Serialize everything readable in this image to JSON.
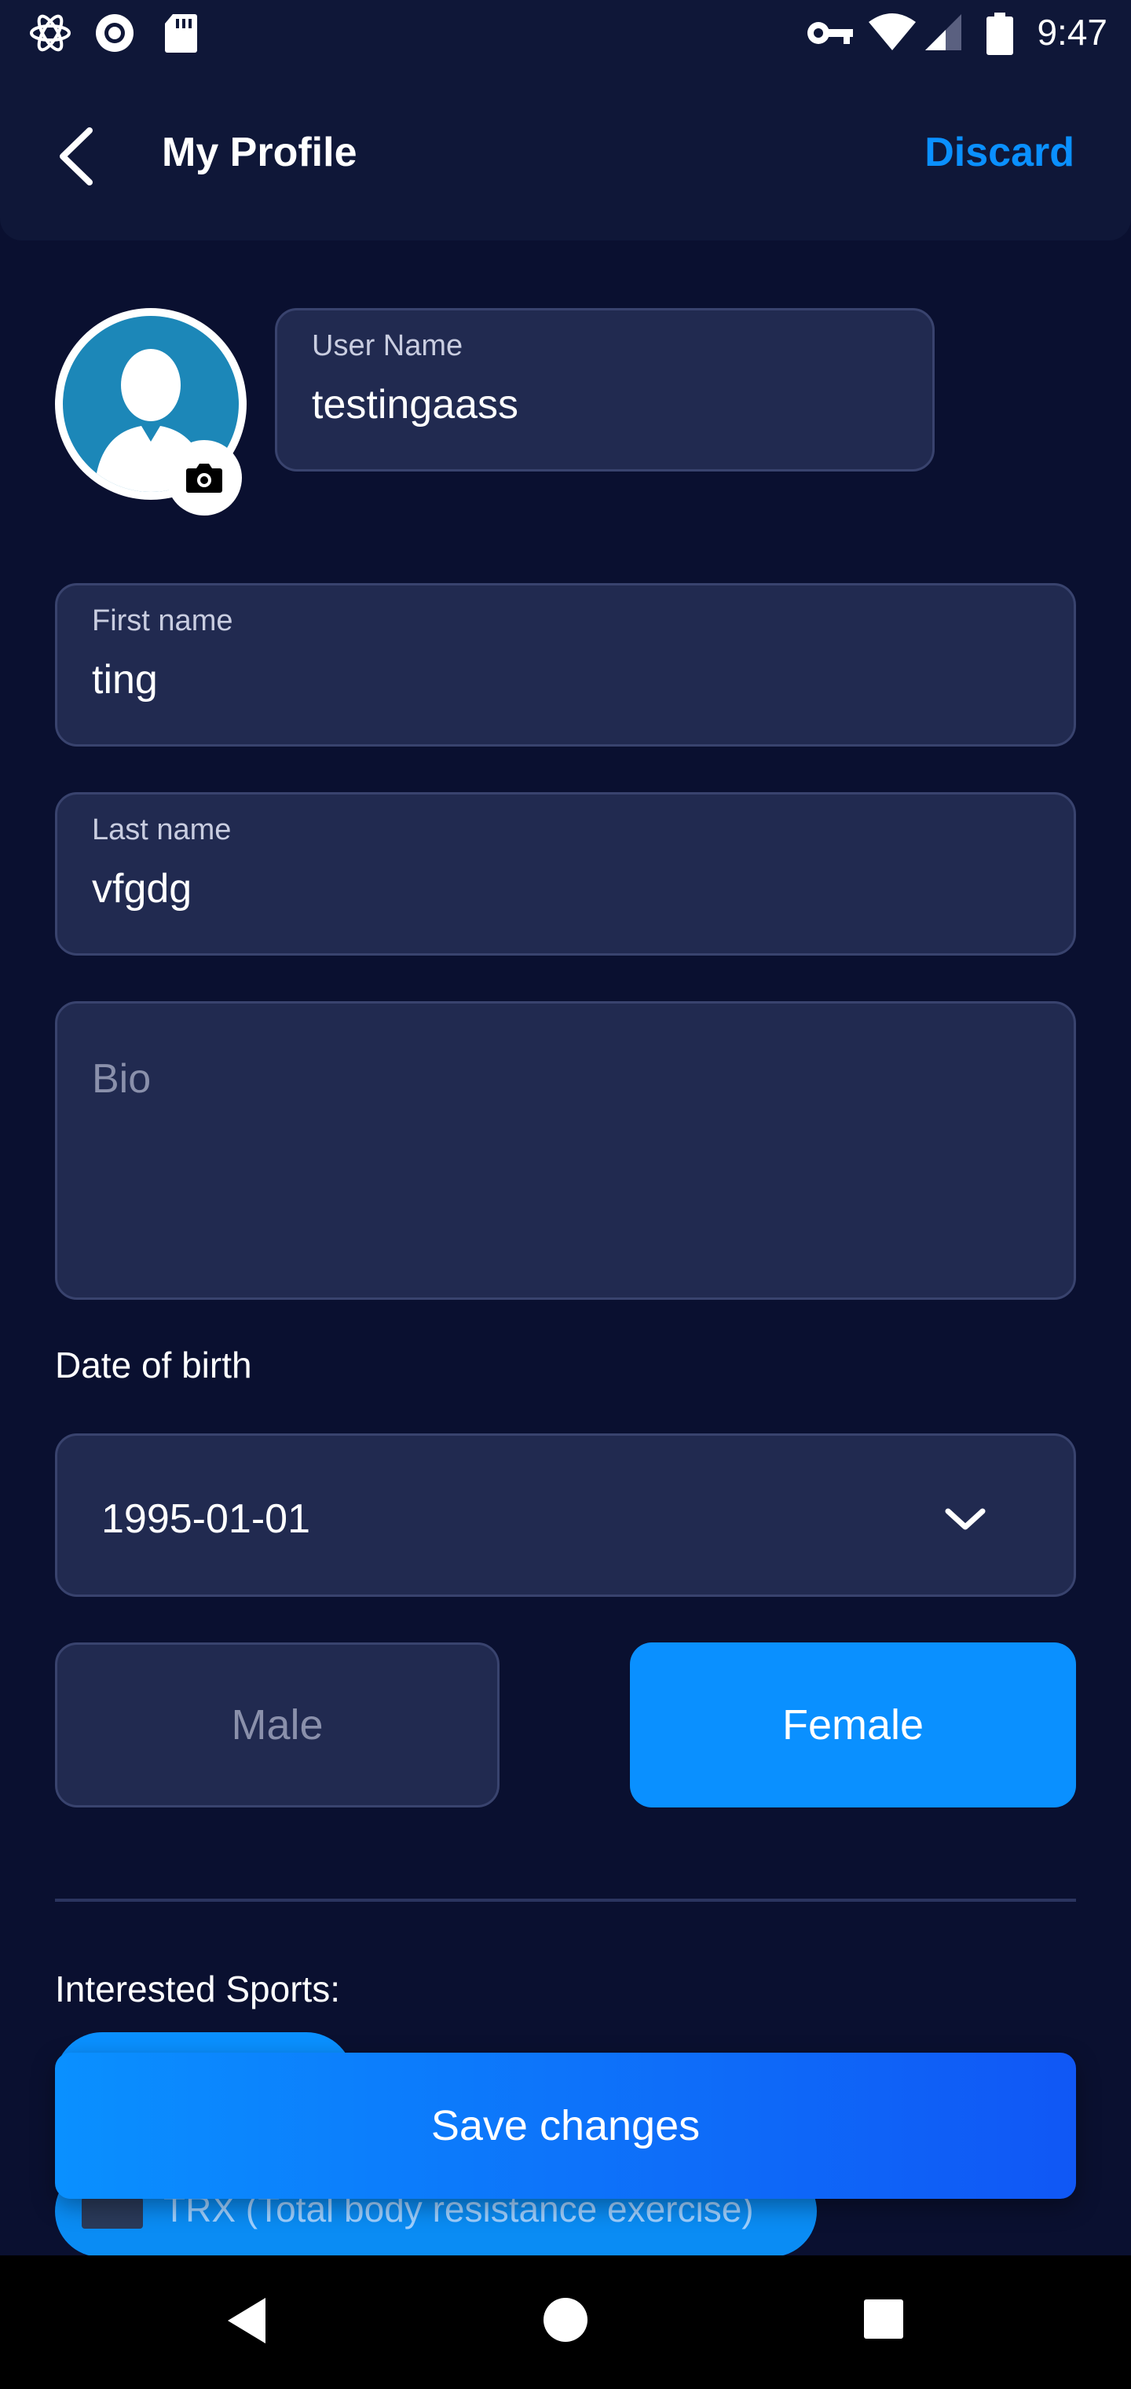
{
  "status_bar": {
    "time": "9:47",
    "left_icons": [
      "atom-icon",
      "record-icon",
      "sd-card-icon"
    ],
    "right_icons": [
      "key-icon",
      "wifi-icon",
      "signal-icon",
      "battery-icon"
    ]
  },
  "app_bar": {
    "title": "My Profile",
    "back_icon": "chevron-left-icon",
    "discard_label": "Discard"
  },
  "profile": {
    "avatar_icon": "user-silhouette-icon",
    "camera_icon": "camera-icon",
    "username": {
      "label": "User Name",
      "value": "testingaass"
    }
  },
  "form": {
    "first_name": {
      "label": "First name",
      "value": "ting"
    },
    "last_name": {
      "label": "Last name",
      "value": "vfgdg"
    },
    "bio": {
      "placeholder": "Bio",
      "value": ""
    },
    "dob": {
      "label": "Date of birth",
      "value": "1995-01-01",
      "icon": "chevron-down-icon"
    },
    "gender": {
      "options": [
        "Male",
        "Female"
      ],
      "selected": "Female"
    }
  },
  "sports": {
    "label": "Interested Sports:",
    "chips": [
      "",
      "TRX (Total body resistance exercise)"
    ]
  },
  "save_label": "Save changes",
  "colors": {
    "background": "#0a1030",
    "surface": "#212a50",
    "accent": "#0a90ff",
    "appbar": "#0f1738"
  },
  "nav_bar": {
    "icons": [
      "back-triangle-icon",
      "home-circle-icon",
      "recents-square-icon"
    ]
  }
}
